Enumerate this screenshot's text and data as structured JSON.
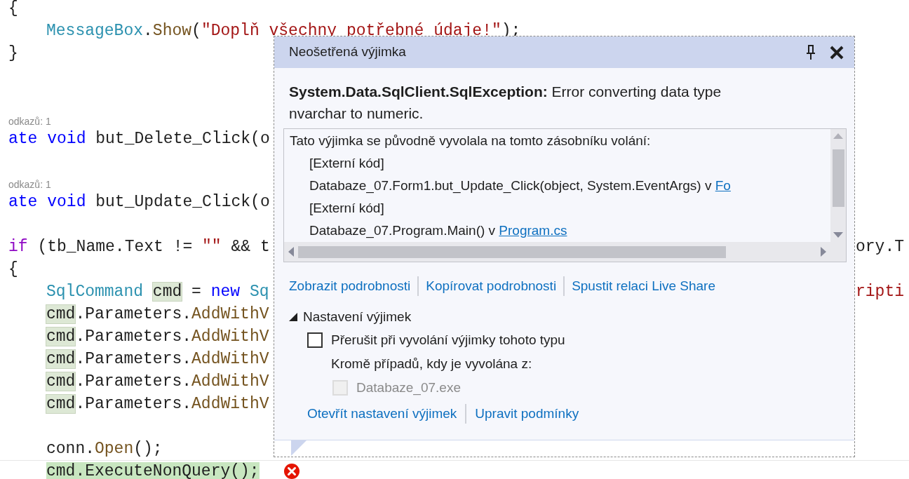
{
  "code_lines": [
    {
      "kind": "code",
      "tokens": [
        {
          "text": "{",
          "kind": "plain"
        }
      ]
    },
    {
      "kind": "code",
      "indent": true,
      "tokens": [
        {
          "text": "MessageBox",
          "kind": "type"
        },
        {
          "text": ".",
          "kind": "plain"
        },
        {
          "text": "Show",
          "kind": "method"
        },
        {
          "text": "(",
          "kind": "plain"
        },
        {
          "text": "\"Doplň všechny potřebné údaje!\"",
          "kind": "string"
        },
        {
          "text": ");",
          "kind": "plain"
        }
      ]
    },
    {
      "kind": "code",
      "tokens": [
        {
          "text": "}",
          "kind": "plain"
        }
      ]
    },
    {
      "kind": "blank"
    },
    {
      "kind": "blank"
    },
    {
      "kind": "codelens",
      "text": "odkazů: 1"
    },
    {
      "kind": "code",
      "tokens": [
        {
          "text": "ate",
          "kind": "keyword"
        },
        {
          "text": " void",
          "kind": "keyword"
        },
        {
          "text": " but_Delete_Click(o",
          "kind": "plain"
        }
      ]
    },
    {
      "kind": "blank"
    },
    {
      "kind": "codelens",
      "text": "odkazů: 1"
    },
    {
      "kind": "code",
      "tokens": [
        {
          "text": "ate",
          "kind": "keyword"
        },
        {
          "text": " void",
          "kind": "keyword"
        },
        {
          "text": " but_Update_Click(o",
          "kind": "plain"
        }
      ]
    },
    {
      "kind": "blank"
    },
    {
      "kind": "code",
      "tokens": [
        {
          "text": "if",
          "kind": "control"
        },
        {
          "text": " (tb_Name.Text != ",
          "kind": "plain"
        },
        {
          "text": "\"\"",
          "kind": "string"
        },
        {
          "text": " && t",
          "kind": "plain"
        }
      ],
      "right": [
        {
          "text": "ory.T",
          "kind": "plain"
        }
      ]
    },
    {
      "kind": "code",
      "tokens": [
        {
          "text": "{",
          "kind": "plain"
        }
      ]
    },
    {
      "kind": "code",
      "indent": true,
      "tokens": [
        {
          "text": "SqlCommand ",
          "kind": "type"
        },
        {
          "text": "cmd",
          "kind": "plain",
          "highlighted": true
        },
        {
          "text": " = ",
          "kind": "plain"
        },
        {
          "text": "new",
          "kind": "keyword"
        },
        {
          "text": " Sq",
          "kind": "type"
        }
      ],
      "right": [
        {
          "text": "ripti",
          "kind": "string"
        }
      ]
    },
    {
      "kind": "code",
      "indent": true,
      "tokens": [
        {
          "text": "cmd",
          "kind": "plain",
          "highlighted": true
        },
        {
          "text": ".Parameters.",
          "kind": "plain"
        },
        {
          "text": "AddWithV",
          "kind": "method"
        }
      ]
    },
    {
      "kind": "code",
      "indent": true,
      "tokens": [
        {
          "text": "cmd",
          "kind": "plain",
          "highlighted": true
        },
        {
          "text": ".Parameters.",
          "kind": "plain"
        },
        {
          "text": "AddWithV",
          "kind": "method"
        }
      ]
    },
    {
      "kind": "code",
      "indent": true,
      "tokens": [
        {
          "text": "cmd",
          "kind": "plain",
          "highlighted": true
        },
        {
          "text": ".Parameters.",
          "kind": "plain"
        },
        {
          "text": "AddWithV",
          "kind": "method"
        }
      ]
    },
    {
      "kind": "code",
      "indent": true,
      "tokens": [
        {
          "text": "cmd",
          "kind": "plain",
          "highlighted": true
        },
        {
          "text": ".Parameters.",
          "kind": "plain"
        },
        {
          "text": "AddWithV",
          "kind": "method"
        }
      ]
    },
    {
      "kind": "code",
      "indent": true,
      "tokens": [
        {
          "text": "cmd",
          "kind": "plain",
          "highlighted": true
        },
        {
          "text": ".Parameters.",
          "kind": "plain"
        },
        {
          "text": "AddWithV",
          "kind": "method"
        }
      ]
    },
    {
      "kind": "blank"
    },
    {
      "kind": "code",
      "indent": true,
      "tokens": [
        {
          "text": "conn.",
          "kind": "plain"
        },
        {
          "text": "Open",
          "kind": "method"
        },
        {
          "text": "();",
          "kind": "plain"
        }
      ]
    },
    {
      "kind": "code",
      "indent": true,
      "current": true,
      "error": true,
      "tokens": [
        {
          "text": "cmd.ExecuteNonQuery();",
          "kind": "plain",
          "current_statement": true
        }
      ]
    }
  ],
  "exception_popup": {
    "title": "Neošetřená výjimka",
    "exception_type": "System.Data.SqlClient.SqlException:",
    "message": "Error converting data type nvarchar to numeric.",
    "stack_header": "Tato výjimka se původně vyvolala na tomto zásobníku volání:",
    "stack_frames": [
      {
        "text": "[Externí kód]"
      },
      {
        "text": "Databaze_07.Form1.but_Update_Click(object, System.EventArgs) v ",
        "link": "Fo"
      },
      {
        "text": "[Externí kód]"
      },
      {
        "text": "Databaze_07.Program.Main() v ",
        "link": "Program.cs"
      }
    ],
    "actions": [
      "Zobrazit podrobnosti",
      "Kopírovat podrobnosti",
      "Spustit relaci Live Share"
    ],
    "settings": {
      "label": "Nastavení výjimek",
      "expanded": true,
      "break_option": {
        "label": "Přerušit při vyvolání výjimky tohoto typu",
        "checked": false
      },
      "except_label": "Kromě případů, kdy je vyvolána z:",
      "modules": [
        {
          "label": "Databaze_07.exe",
          "checked": false,
          "disabled": true
        }
      ]
    },
    "footer_actions": [
      "Otevřít nastavení výjimek",
      "Upravit podmínky"
    ]
  }
}
